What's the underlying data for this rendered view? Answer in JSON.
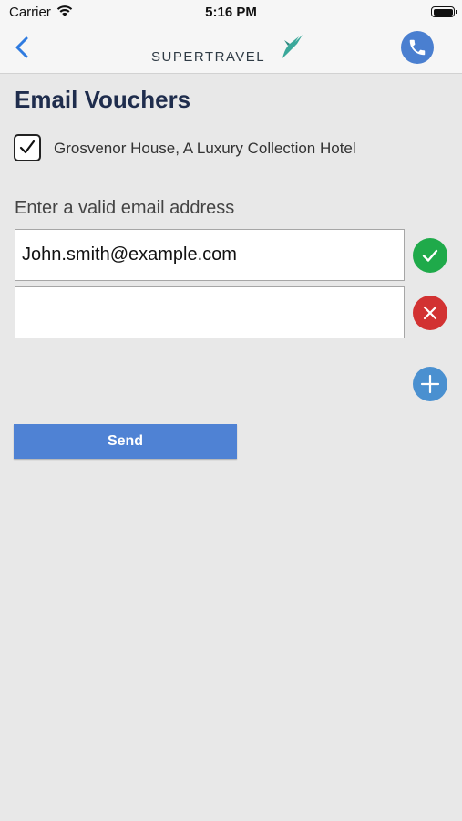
{
  "status_bar": {
    "carrier": "Carrier",
    "time": "5:16 PM"
  },
  "nav": {
    "logo_text": "SUPERTRAVEL",
    "back_icon": "chevron-left-icon",
    "call_icon": "phone-icon"
  },
  "page": {
    "title": "Email Vouchers",
    "hotel": {
      "label": "Grosvenor House, A Luxury Collection Hotel",
      "checked": true
    },
    "email_label": "Enter a valid email address",
    "emails": [
      {
        "value": "John.smith@example.com",
        "status": "valid"
      },
      {
        "value": "",
        "status": "remove"
      }
    ],
    "send_label": "Send"
  },
  "colors": {
    "accent": "#4f82d4",
    "valid": "#1faa4a",
    "remove": "#d23232",
    "add": "#4a90d0",
    "title": "#1f2d4d"
  }
}
